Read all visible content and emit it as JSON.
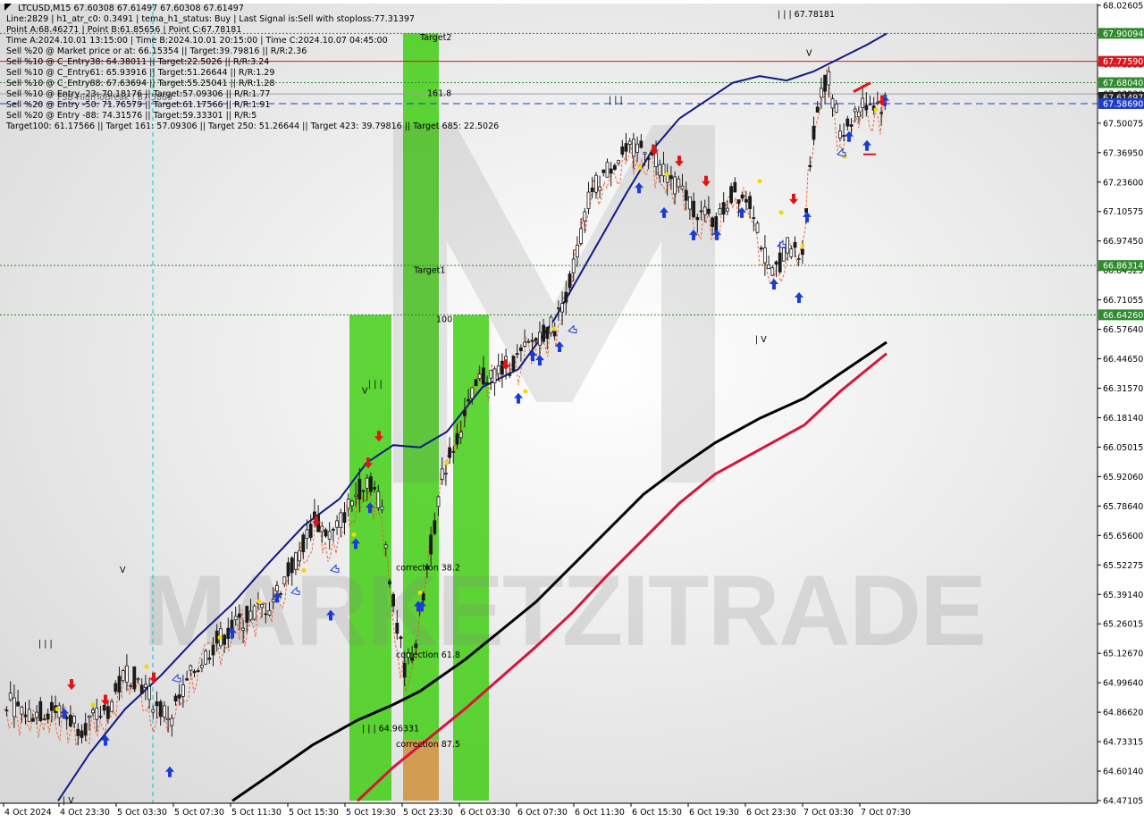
{
  "header": {
    "line1": "LTCUSD,M15  67.60308 67.61497 67.60308 67.61497",
    "line2": "Line:2829  | h1_atr_c0: 0.3491  | tema_h1_status: Buy  | Last Signal is:Sell with stoploss:77.31397",
    "line3": "Point A:68.46271  | Point B:61.85656  | Point C:67.78181",
    "line4": "Time A:2024.10.01 13:15:00  | Time B:2024.10.01 20:15:00  | Time C:2024.10.07 04:45:00",
    "line5": "Sell %20 @ Market price or at: 66.15354  || Target:39.79816  || R/R:2.36",
    "line6": "Sell %10 @ C_Entry38: 64.38011  || Target:22.5026  || R/R:3.24",
    "line7": "Sell %10 @ C_Entry61: 65.93916  || Target:51.26644  || R/R:1.29",
    "line8": "Sell %10 @ C_Entry88: 67.63694  || Target:55.25041  || R/R:1.28",
    "line9": "Sell %10 @ Entry -23: 70.18176  || Target:57.09306  || R/R:1.77",
    "line10": "Sell %20 @ Entry -50: 71.76579  || Target:61.17566  || R/R:1.91",
    "line11": "Sell %20 @ Entry -88: 74.31576  || Target:59.33301  || R/R:5",
    "line12": "Target100: 61.17566  || Target 161: 57.09306  || Target 250: 51.26644  || Target 423: 39.79816  || Target 685: 22.5026",
    "overlap_label": "FSB-HighToBreak | 67.5869"
  },
  "watermark": {
    "brand": "MARKETZITRADE"
  },
  "chart_data": {
    "type": "candlestick",
    "symbol": "LTCUSD",
    "timeframe": "M15",
    "ylim": [
      64.47105,
      68.02605
    ],
    "y_ticks": [
      "68.02605",
      "67.89480",
      "67.76355",
      "67.63230",
      "67.50075",
      "67.36950",
      "67.23600",
      "67.10575",
      "66.97450",
      "66.84325",
      "66.71055",
      "66.57640",
      "66.44650",
      "66.31570",
      "66.18140",
      "66.05015",
      "65.92060",
      "65.78640",
      "65.65600",
      "65.52275",
      "65.39140",
      "65.26015",
      "65.12670",
      "64.99640",
      "64.86620",
      "64.73315",
      "64.60140",
      "64.47105"
    ],
    "x_labels": [
      "4 Oct 2024",
      "4 Oct 23:30",
      "5 Oct 03:30",
      "5 Oct 07:30",
      "5 Oct 11:30",
      "5 Oct 15:30",
      "5 Oct 19:30",
      "5 Oct 23:30",
      "6 Oct 03:30",
      "6 Oct 07:30",
      "6 Oct 11:30",
      "6 Oct 15:30",
      "6 Oct 19:30",
      "6 Oct 23:30",
      "7 Oct 03:30",
      "7 Oct 07:30"
    ],
    "price_badges": [
      {
        "value": 67.90094,
        "label": "67.90094",
        "color": "#2e8b2e"
      },
      {
        "value": 67.7759,
        "label": "67.77590",
        "color": "#e0141e"
      },
      {
        "value": 67.6804,
        "label": "67.68040",
        "color": "#2e8b2e"
      },
      {
        "value": 67.61497,
        "label": "67.61497",
        "color": "#222222"
      },
      {
        "value": 67.5869,
        "label": "67.58690",
        "color": "#1e3cc8"
      },
      {
        "value": 66.86314,
        "label": "66.86314",
        "color": "#2e8b2e"
      },
      {
        "value": 66.6426,
        "label": "66.64260",
        "color": "#2e8b2e"
      }
    ],
    "horizontal_lines": [
      {
        "value": 67.90094,
        "color": "#2e8b2e",
        "style": "dotted"
      },
      {
        "value": 67.7759,
        "color": "#e0141e",
        "style": "solid"
      },
      {
        "value": 67.6804,
        "color": "#2e8b2e",
        "style": "dotted"
      },
      {
        "value": 67.63,
        "color": "#9aa0a6",
        "style": "solid"
      },
      {
        "value": 67.5869,
        "color": "#1e3cc8",
        "style": "dashed"
      },
      {
        "value": 66.86314,
        "color": "#2e8b2e",
        "style": "dotted"
      },
      {
        "value": 66.6426,
        "color": "#2e8b2e",
        "style": "dotted"
      }
    ],
    "zone_labels": {
      "target2": "Target2",
      "target1": "Target1",
      "level161": "161.8",
      "level100": "100",
      "corr382": "correction 38.2",
      "corr618": "correction 61.8",
      "corr875": "correction 87.5",
      "level_b": "| | | 64.96331",
      "top_partial": "| | | 67.78181"
    },
    "wave_labels": [
      "V",
      "| | |",
      "| V",
      "| | |",
      "V",
      "| | |",
      "| V",
      "V"
    ]
  }
}
